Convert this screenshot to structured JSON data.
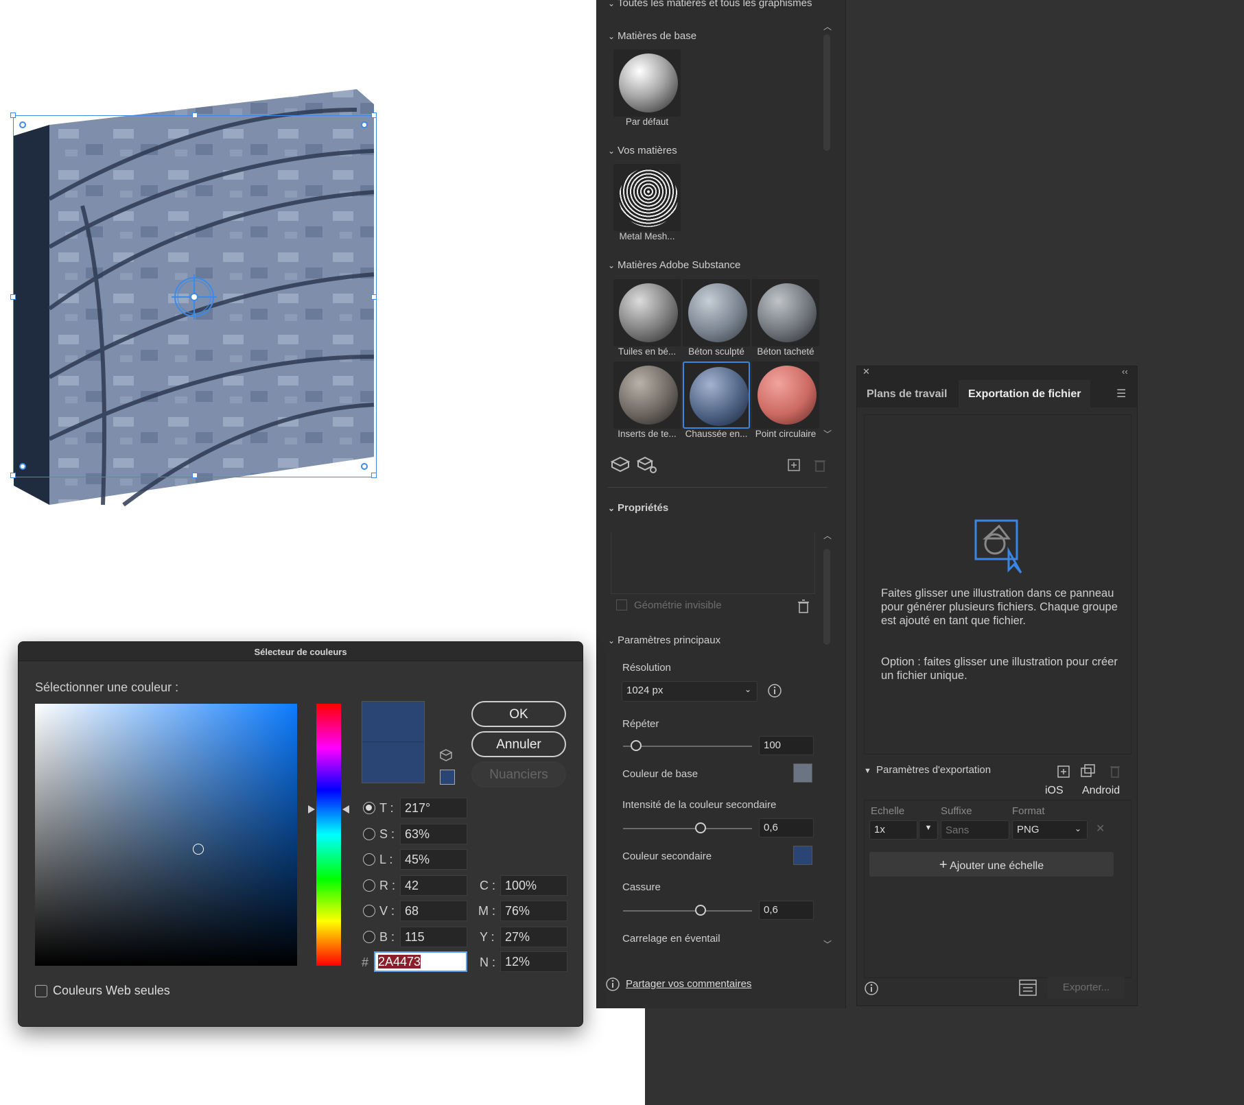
{
  "materials_panel": {
    "top_section": "Toutes les matières et tous les graphismes",
    "base_section": "Matières de base",
    "base_items": [
      {
        "label": "Par défaut"
      }
    ],
    "your_section": "Vos matières",
    "your_items": [
      {
        "label": "Metal Mesh..."
      }
    ],
    "substance_section": "Matières Adobe Substance",
    "substance_items": [
      {
        "label": "Tuiles en bé..."
      },
      {
        "label": "Béton sculpté"
      },
      {
        "label": "Béton tacheté"
      },
      {
        "label": "Inserts de te..."
      },
      {
        "label": "Chaussée en..."
      },
      {
        "label": "Point circulaire"
      }
    ],
    "properties_section": "Propriétés",
    "invisible_geometry": "Géométrie invisible",
    "main_params_section": "Paramètres principaux",
    "resolution_label": "Résolution",
    "resolution_value": "1024 px",
    "repeat_label": "Répéter",
    "repeat_value": "100",
    "repeat_fraction": 0.1,
    "base_color_label": "Couleur de base",
    "base_color": "#6b7483",
    "secondary_intensity_label": "Intensité de la couleur secondaire",
    "secondary_intensity_value": "0,6",
    "secondary_intensity_fraction": 0.6,
    "secondary_color_label": "Couleur secondaire",
    "secondary_color": "#2a4473",
    "break_label": "Cassure",
    "break_value": "0,6",
    "break_fraction": 0.6,
    "fan_tiling_label": "Carrelage en éventail",
    "feedback_link": "Partager vos commentaires"
  },
  "export_panel": {
    "tabs": [
      {
        "label": "Plans de travail"
      },
      {
        "label": "Exportation de fichier"
      }
    ],
    "instructions_1": "Faites glisser une illustration dans ce panneau pour générer plusieurs fichiers. Chaque groupe est ajouté en tant que fichier.",
    "instructions_2": "Option : faites glisser une illustration pour créer un fichier unique.",
    "export_params": "Paramètres d'exportation",
    "ios": "iOS",
    "android": "Android",
    "col_scale": "Echelle",
    "col_suffix": "Suffixe",
    "col_format": "Format",
    "scale_value": "1x",
    "suffix_placeholder": "Sans",
    "format_value": "PNG",
    "add_scale": "Ajouter une échelle",
    "export_button": "Exporter..."
  },
  "color_picker": {
    "title": "Sélecteur de couleurs",
    "prompt": "Sélectionner une couleur :",
    "ok": "OK",
    "cancel": "Annuler",
    "swatches": "Nuanciers",
    "web_only": "Couleurs Web seules",
    "current_color": "#2a4473",
    "T": "217°",
    "S": "63%",
    "L": "45%",
    "R": "42",
    "V": "68",
    "B": "115",
    "hex": "2A4473",
    "C": "100%",
    "M": "76%",
    "Y": "27%",
    "N": "12%",
    "labels": {
      "T": "T :",
      "S": "S :",
      "L": "L :",
      "R": "R :",
      "V": "V :",
      "B": "B :",
      "C": "C :",
      "M": "M :",
      "Y": "Y :",
      "N": "N :",
      "hash": "#"
    }
  }
}
